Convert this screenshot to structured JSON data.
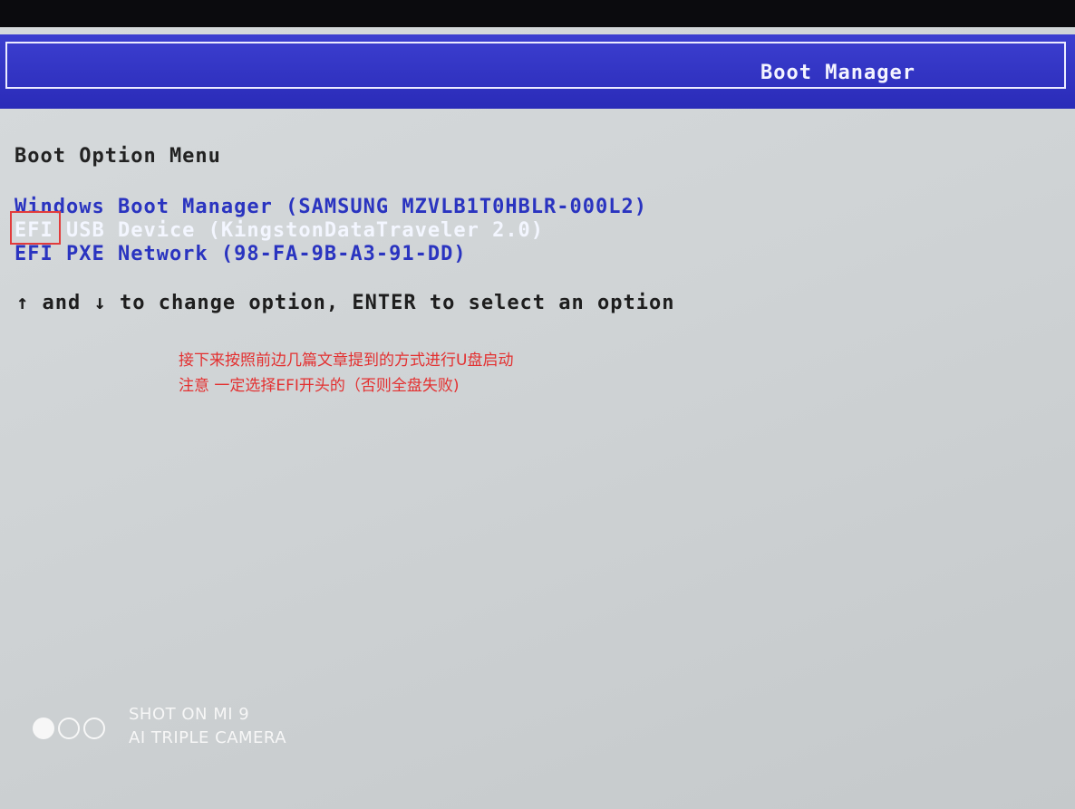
{
  "header": {
    "title": "Boot Manager"
  },
  "menu": {
    "heading": "Boot Option Menu",
    "options": [
      {
        "label": "Windows Boot Manager (SAMSUNG MZVLB1T0HBLR-000L2)",
        "selected": false
      },
      {
        "label": "EFI USB Device (KingstonDataTraveler 2.0)",
        "selected": true
      },
      {
        "label": "EFI PXE Network (98-FA-9B-A3-91-DD)",
        "selected": false
      }
    ],
    "help": "↑ and ↓ to change option, ENTER to select an option"
  },
  "annotation": {
    "line1": "接下来按照前边几篇文章提到的方式进行U盘启动",
    "line2": "注意 一定选择EFI开头的（否则全盘失败)"
  },
  "watermark": {
    "line1": "SHOT ON MI 9",
    "line2": "AI TRIPLE CAMERA"
  }
}
